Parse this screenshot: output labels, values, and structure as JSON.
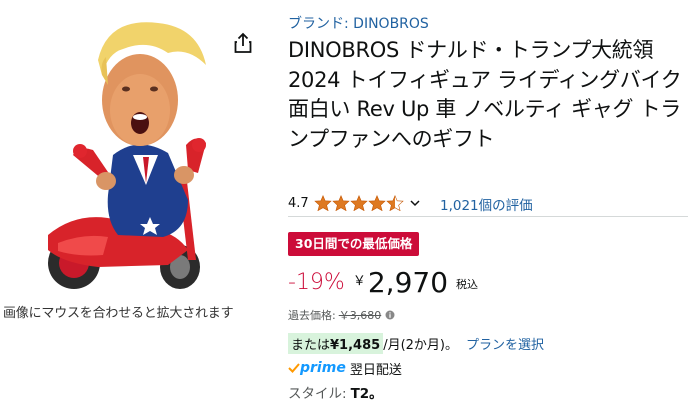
{
  "image_panel": {
    "zoom_hint": "画像にマウスを合わせると拡大されます",
    "share_icon": "share-icon"
  },
  "product": {
    "brand": "ブランド: DINOBROS",
    "title": "DINOBROS ドナルド・トランプ大統領 2024 トイフィギュア ライディングバイク 面白い Rev Up 車 ノベルティ ギャグ トランプファンへのギフト",
    "rating_value": "4.7",
    "rating_stars": 4.5,
    "reviews": "1,021個の評価",
    "deal_badge": "30日間での最低価格",
    "discount": "-19%",
    "currency": "￥",
    "price": "2,970",
    "tax": "税込",
    "list_price_label": "過去価格:",
    "list_price": "￥3,680",
    "installment_prefix": "または",
    "installment_amount": "¥1,485",
    "installment_suffix": "/月(2か月)。",
    "plan_link": "プランを選択",
    "prime_label": "prime",
    "delivery": "翌日配送",
    "style_label": "スタイル:",
    "style_value": "T2。"
  },
  "colors": {
    "link": "#2162a1",
    "deal": "#cc0c39",
    "star": "#de7921",
    "prime": "#1399ff"
  }
}
